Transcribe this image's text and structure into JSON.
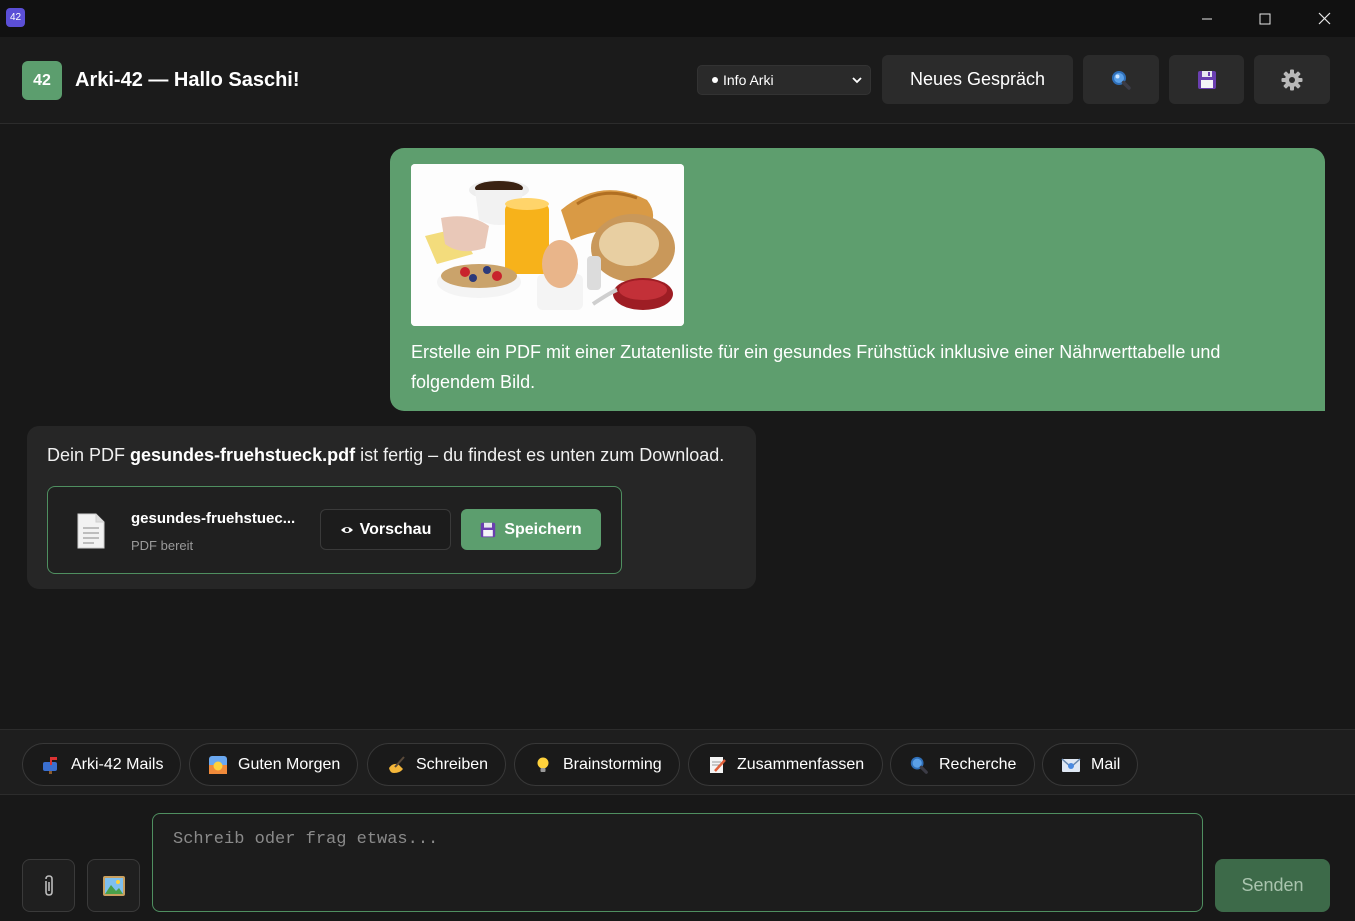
{
  "window": {
    "app_icon_label": "42"
  },
  "header": {
    "logo": "42",
    "title": "Arki-42 — Hallo Saschi!",
    "mode_selected": "Info Arki",
    "new_chat_label": "Neues Gespräch"
  },
  "messages": {
    "user": {
      "text": "Erstelle ein PDF mit einer Zutatenliste für ein gesundes Frühstück inklusive einer Nährwerttabelle und folgendem Bild."
    },
    "assistant": {
      "text_before": "Dein PDF ",
      "filename_bold": "gesundes-fruehstueck.pdf",
      "text_after": " ist fertig – du findest es unten zum Download.",
      "file_card": {
        "name": "gesundes-fruehstuec...",
        "status": "PDF bereit",
        "preview_label": "Vorschau",
        "save_label": "Speichern"
      }
    }
  },
  "quick_actions": [
    {
      "label": "Arki-42 Mails",
      "icon": "mailbox-icon"
    },
    {
      "label": "Guten Morgen",
      "icon": "sunrise-icon"
    },
    {
      "label": "Schreiben",
      "icon": "writing-hand-icon"
    },
    {
      "label": "Brainstorming",
      "icon": "lightbulb-icon"
    },
    {
      "label": "Zusammenfassen",
      "icon": "memo-icon"
    },
    {
      "label": "Recherche",
      "icon": "magnifier-icon"
    },
    {
      "label": "Mail",
      "icon": "envelope-icon"
    }
  ],
  "composer": {
    "placeholder": "Schreib oder frag etwas...",
    "value": "",
    "send_label": "Senden"
  },
  "colors": {
    "accent": "#5e9e6e",
    "background": "#181818",
    "send_disabled": "#3d6a49"
  }
}
